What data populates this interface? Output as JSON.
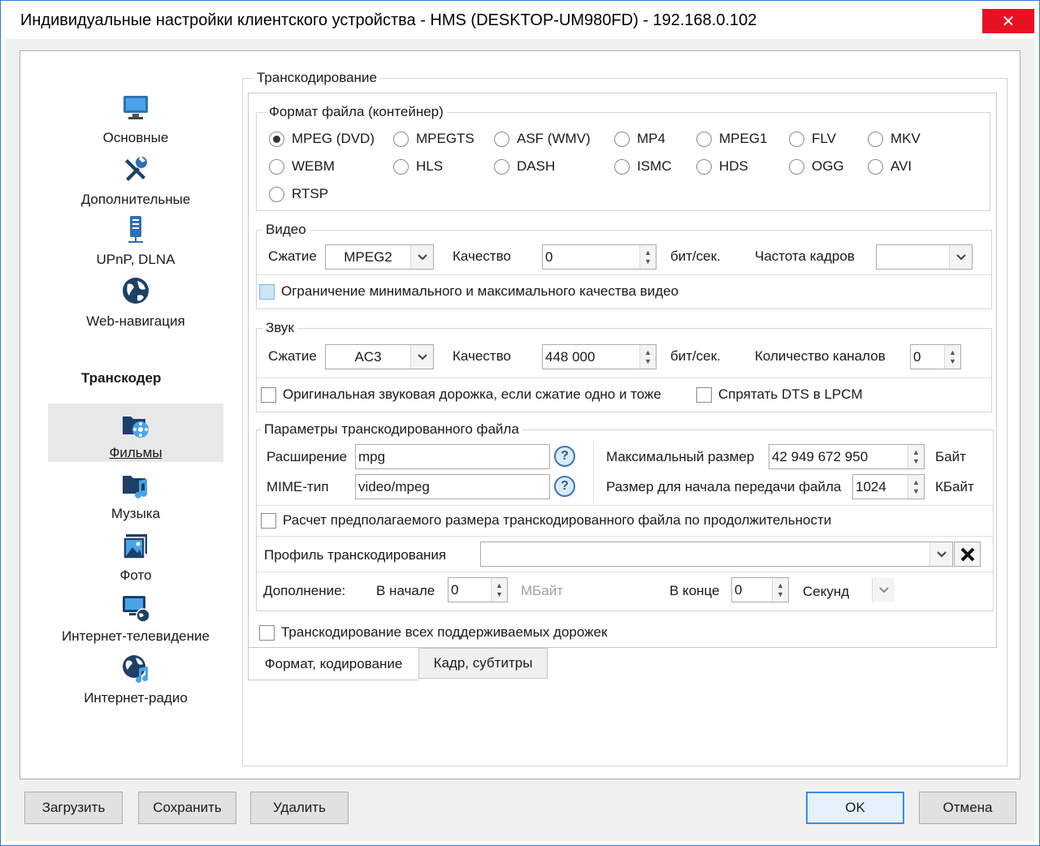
{
  "window": {
    "title": "Индивидуальные настройки клиентского устройства - HMS (DESKTOP-UM980FD) - 192.168.0.102",
    "close_glyph": "✕"
  },
  "nav": {
    "items": [
      {
        "label": "Основные",
        "icon": "monitor-icon"
      },
      {
        "label": "Дополнительные",
        "icon": "tools-icon"
      },
      {
        "label": "UPnP, DLNA",
        "icon": "network-device-icon"
      },
      {
        "label": "Web-навигация",
        "icon": "globe-icon"
      }
    ],
    "section_heading": "Транскодер",
    "sub_items": [
      {
        "label": "Фильмы",
        "icon": "film-folder-icon",
        "selected": true
      },
      {
        "label": "Музыка",
        "icon": "music-folder-icon"
      },
      {
        "label": "Фото",
        "icon": "photo-icon"
      },
      {
        "label": "Интернет-телевидение",
        "icon": "internet-tv-icon"
      },
      {
        "label": "Интернет-радио",
        "icon": "internet-radio-icon"
      }
    ]
  },
  "transcoding": {
    "group_title": "Транскодирование",
    "container": {
      "title": "Формат файла (контейнер)",
      "options": [
        "MPEG (DVD)",
        "MPEGTS",
        "ASF (WMV)",
        "MP4",
        "MPEG1",
        "FLV",
        "MKV",
        "WEBM",
        "HLS",
        "DASH",
        "ISMC",
        "HDS",
        "OGG",
        "AVI",
        "RTSP"
      ],
      "selected": "MPEG (DVD)"
    },
    "video": {
      "title": "Видео",
      "compression_label": "Сжатие",
      "compression_value": "MPEG2",
      "quality_label": "Качество",
      "quality_value": "0",
      "unit": "бит/сек.",
      "framerate_label": "Частота кадров",
      "framerate_value": "",
      "limit_label": "Ограничение минимального и максимального качества видео"
    },
    "audio": {
      "title": "Звук",
      "compression_label": "Сжатие",
      "compression_value": "AC3",
      "quality_label": "Качество",
      "quality_value": "448 000",
      "unit": "бит/сек.",
      "channels_label": "Количество каналов",
      "channels_value": "0",
      "original_track_label": "Оригинальная звуковая дорожка, если сжатие одно и тоже",
      "hide_dts_label": "Спрятать DTS в LPCM"
    },
    "file_params": {
      "title": "Параметры транскодированного файла",
      "extension_label": "Расширение",
      "extension_value": "mpg",
      "mime_label": "MIME-тип",
      "mime_value": "video/mpeg",
      "max_size_label": "Максимальный размер",
      "max_size_value": "42 949 672 950",
      "max_size_unit": "Байт",
      "start_size_label": "Размер для начала передачи файла",
      "start_size_value": "1024",
      "start_size_unit": "КБайт",
      "estimate_label": "Расчет предполагаемого размера транскодированного файла по продолжительности",
      "profile_label": "Профиль транскодирования",
      "profile_value": "",
      "padding_label": "Дополнение:",
      "start_label": "В начале",
      "start_value": "0",
      "start_unit": "МБайт",
      "end_label": "В конце",
      "end_value": "0",
      "end_unit": "Секунд"
    },
    "all_tracks_label": "Транскодирование всех поддерживаемых дорожек",
    "tabs": [
      "Формат, кодирование",
      "Кадр, субтитры"
    ]
  },
  "buttons": {
    "load": "Загрузить",
    "save": "Сохранить",
    "delete": "Удалить",
    "ok": "OK",
    "cancel": "Отмена"
  },
  "colors": {
    "close": "#e81123",
    "accent": "#3c8de0",
    "icon_blue": "#2e6fb7"
  }
}
